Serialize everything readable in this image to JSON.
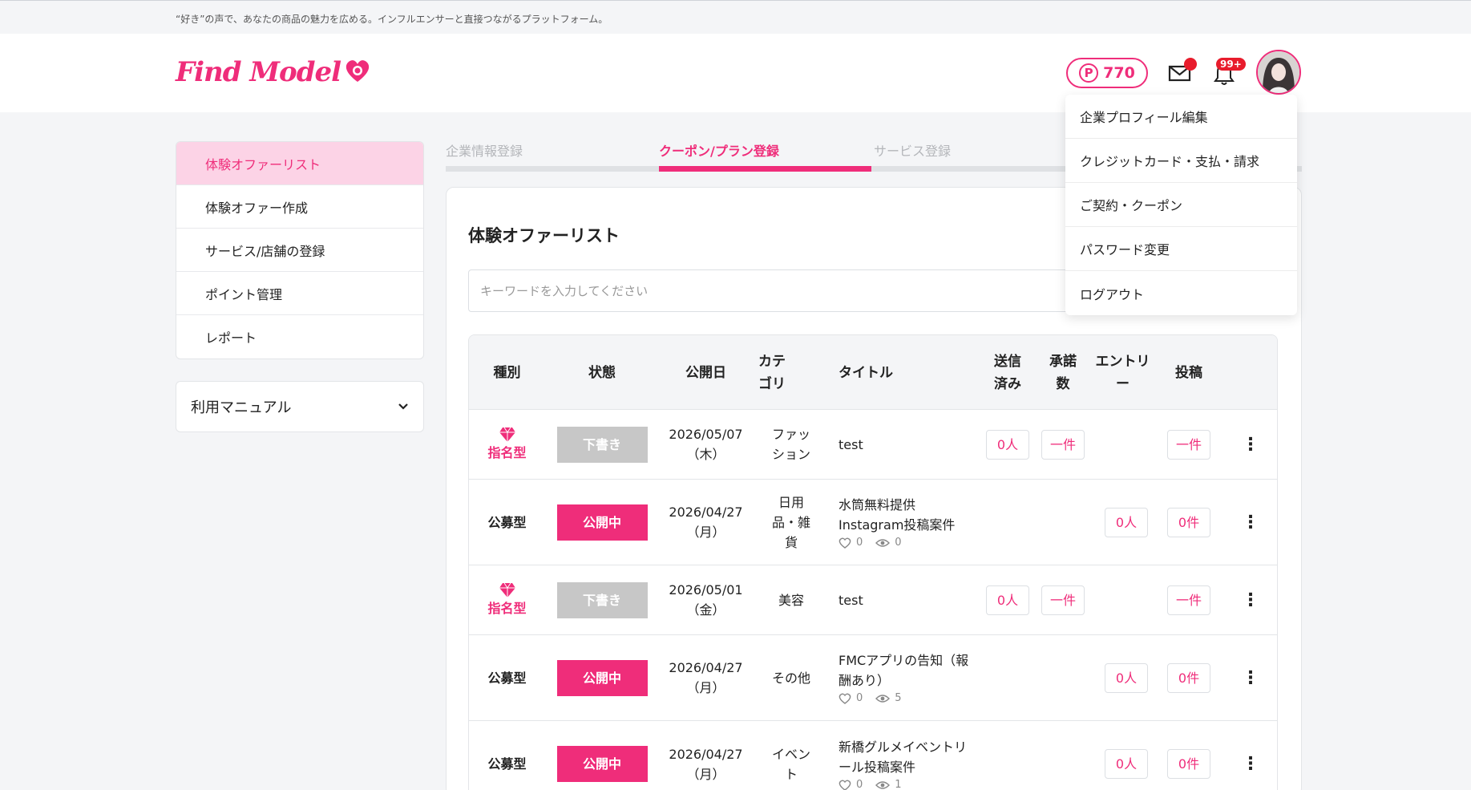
{
  "tagline": "“好き”の声で、あなたの商品の魅力を広める。インフルエンサーと直接つながるプラットフォーム。",
  "logo_text": "Find Model",
  "points": "770",
  "points_symbol": "P",
  "notification_badge": "99+",
  "brand_color": "#ef2d7a",
  "sidebar": {
    "items": [
      {
        "label": "体験オファーリスト"
      },
      {
        "label": "体験オファー作成"
      },
      {
        "label": "サービス/店舗の登録"
      },
      {
        "label": "ポイント管理"
      },
      {
        "label": "レポート"
      }
    ],
    "manual_label": "利用マニュアル"
  },
  "steps": [
    {
      "label": "企業情報登録"
    },
    {
      "label": "クーポン/プラン登録"
    },
    {
      "label": "サービス登録"
    }
  ],
  "main": {
    "title": "体験オファーリスト",
    "search_placeholder": "キーワードを入力してください"
  },
  "table": {
    "headers": {
      "type": "種別",
      "status": "状態",
      "date": "公開日",
      "category": "カテゴリ",
      "title": "タイトル",
      "sent": "送信済み",
      "approved": "承諾数",
      "entry": "エントリー",
      "posts": "投稿"
    },
    "rows": [
      {
        "type": "指名型",
        "status": "下書き",
        "date": "2026/05/07（木）",
        "category": "ファッション",
        "title": "test",
        "sent": "0人",
        "approved": "一件",
        "entry": "",
        "posts": "一件"
      },
      {
        "type": "公募型",
        "status": "公開中",
        "date": "2026/04/27（月）",
        "category": "日用品・雑貨",
        "title": "水筒無料提供Instagram投稿案件",
        "likes": "0",
        "views": "0",
        "sent": "",
        "approved": "",
        "entry": "0人",
        "posts": "0件"
      },
      {
        "type": "指名型",
        "status": "下書き",
        "date": "2026/05/01（金）",
        "category": "美容",
        "title": "test",
        "sent": "0人",
        "approved": "一件",
        "entry": "",
        "posts": "一件"
      },
      {
        "type": "公募型",
        "status": "公開中",
        "date": "2026/04/27（月）",
        "category": "その他",
        "title": "FMCアプリの告知（報酬あり）",
        "likes": "0",
        "views": "5",
        "sent": "",
        "approved": "",
        "entry": "0人",
        "posts": "0件"
      },
      {
        "type": "公募型",
        "status": "公開中",
        "date": "2026/04/27（月）",
        "category": "イベント",
        "title": "新橋グルメイベントリール投稿案件",
        "likes": "0",
        "views": "1",
        "sent": "",
        "approved": "",
        "entry": "0人",
        "posts": "0件"
      }
    ]
  },
  "account_menu": {
    "items": [
      {
        "label": "企業プロフィール編集"
      },
      {
        "label": "クレジットカード・支払・請求"
      },
      {
        "label": "ご契約・クーポン"
      },
      {
        "label": "パスワード変更"
      },
      {
        "label": "ログアウト"
      }
    ]
  }
}
